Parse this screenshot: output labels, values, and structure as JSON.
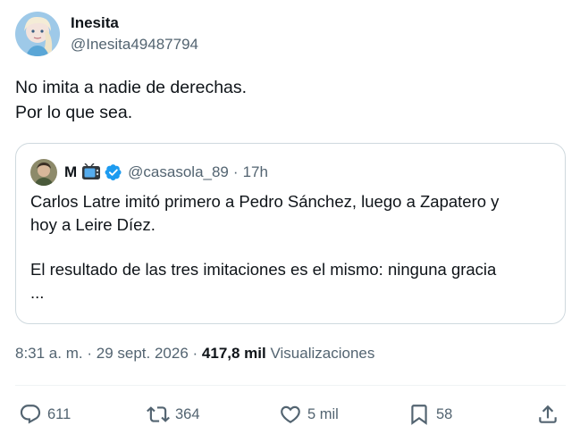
{
  "post": {
    "author_name": "Inesita",
    "author_handle": "@Inesita49487794",
    "text_lines": [
      "No imita a nadie de derechas.",
      "Por lo que sea."
    ]
  },
  "quoted_post": {
    "author_name": "M",
    "author_handle": "@casasola_89",
    "separator": "·",
    "time": "17h",
    "paragraph1_lines": [
      "Carlos Latre imitó primero a Pedro Sánchez, luego a Zapatero y",
      "hoy a Leire Díez."
    ],
    "paragraph2_lines": [
      "El resultado de las tres imitaciones es el mismo: ninguna gracia",
      "..."
    ]
  },
  "meta": {
    "time": "8:31 a. m.",
    "sep1": "·",
    "date": "29 sept. 2026",
    "sep2": "·",
    "views_count": "417,8 mil",
    "views_label": "Visualizaciones"
  },
  "actions": {
    "replies": "611",
    "reposts": "364",
    "likes": "5 mil",
    "bookmarks": "58"
  },
  "icons": {
    "reply": "reply-icon",
    "repost": "repost-icon",
    "like": "heart-icon",
    "bookmark": "bookmark-icon",
    "share": "share-icon",
    "verified": "verified-badge-icon",
    "tv": "tv-emoji-icon"
  },
  "colors": {
    "text": "#0f1419",
    "secondary": "#536471",
    "border": "#cfd9de",
    "verified": "#1d9bf0"
  }
}
